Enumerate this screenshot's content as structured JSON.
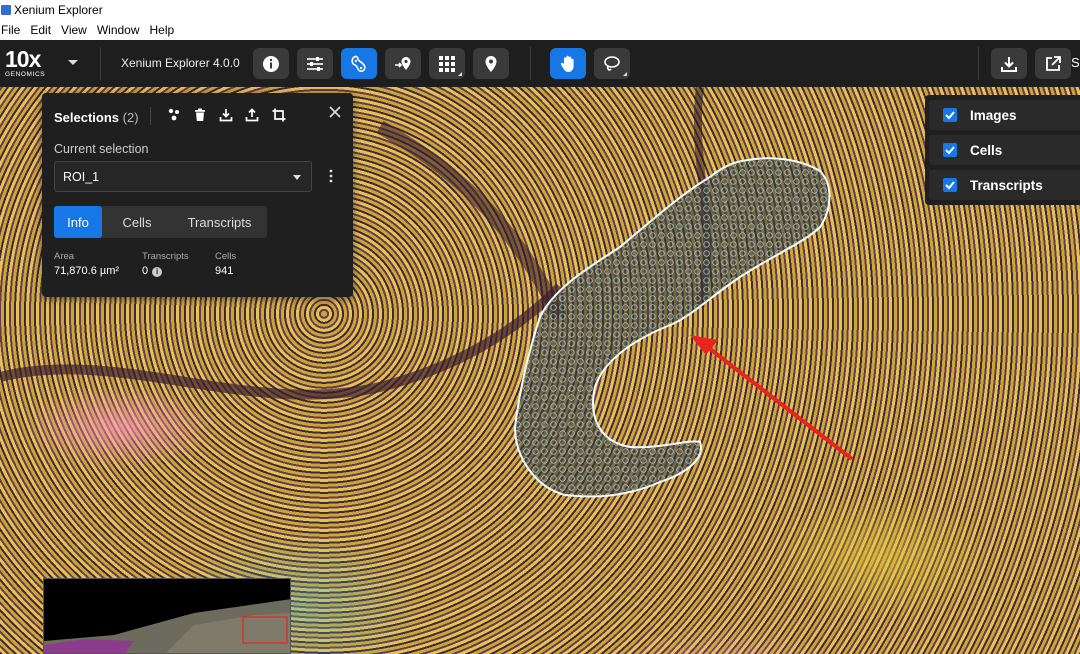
{
  "window": {
    "title": "Xenium Explorer"
  },
  "menu": [
    "File",
    "Edit",
    "View",
    "Window",
    "Help"
  ],
  "brand": {
    "logo_main": "10x",
    "logo_sub": "GENOMICS"
  },
  "toolbar": {
    "app_title": "Xenium Explorer 4.0.0",
    "share_label": "S",
    "buttons": [
      "info-icon",
      "sliders-icon",
      "cell-selection-icon",
      "add-location-icon",
      "grid-icon",
      "pin-icon",
      "hand-pan-icon",
      "lasso-icon",
      "download-icon",
      "export-icon"
    ]
  },
  "selections": {
    "title": "Selections",
    "count": "(2)",
    "current_label": "Current selection",
    "current_value": "ROI_1",
    "tabs": [
      "Info",
      "Cells",
      "Transcripts"
    ],
    "stats": {
      "area_label": "Area",
      "area_value": "71,870.6 µm²",
      "transcripts_label": "Transcripts",
      "transcripts_value": "0",
      "cells_label": "Cells",
      "cells_value": "941"
    }
  },
  "layers": [
    "Images",
    "Cells",
    "Transcripts"
  ],
  "colors": {
    "accent": "#1677e6",
    "panel": "#1f1f1f",
    "toolbar": "#1e1e1e",
    "arrow": "#e8241c",
    "roi_outline": "#ffffff"
  }
}
